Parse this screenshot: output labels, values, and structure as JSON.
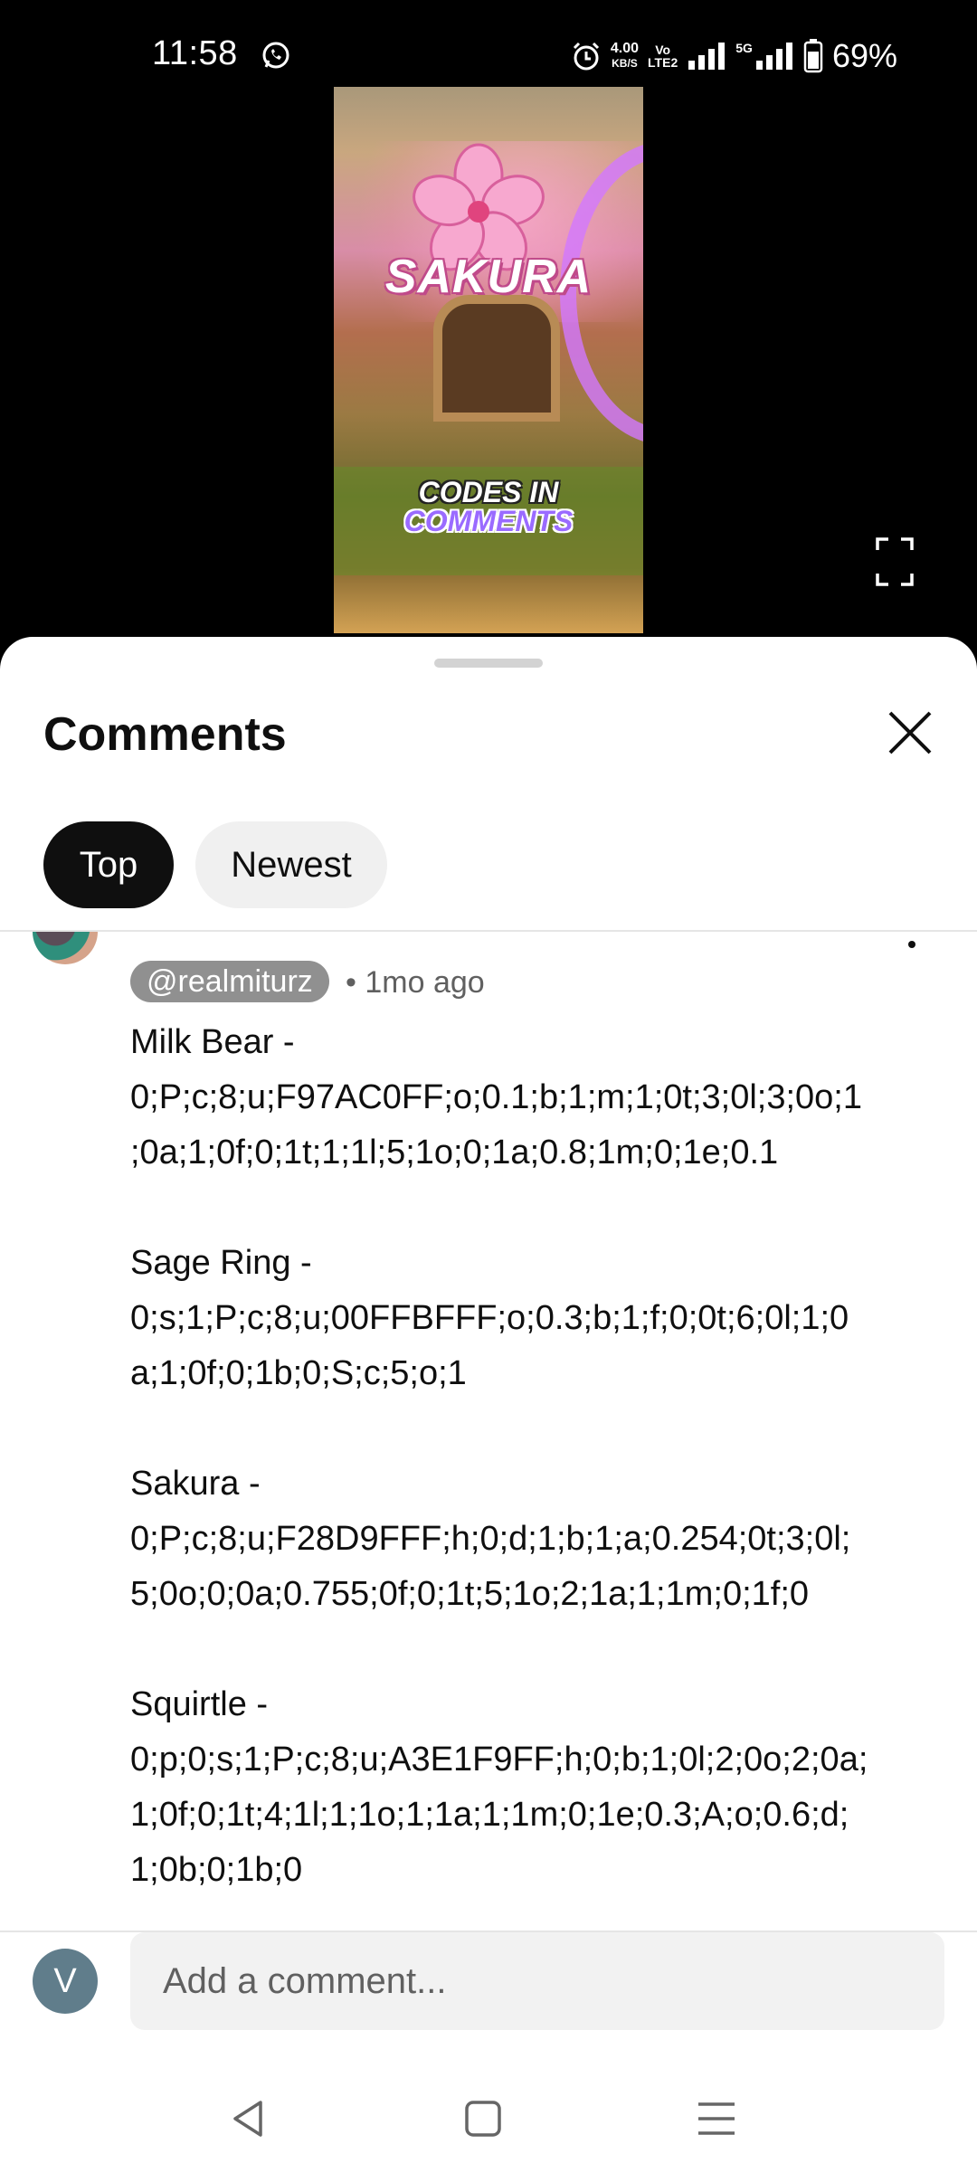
{
  "status_bar": {
    "time": "11:58",
    "net_speed_value": "4.00",
    "net_speed_unit": "KB/S",
    "vo_label": "Vo",
    "lte_label": "LTE2",
    "five_g_label": "5G",
    "battery": "69%"
  },
  "video": {
    "title_overlay": "SAKURA",
    "caption_line1": "CODES IN",
    "caption_line2": "COMMENTS",
    "progress_fraction": 0.645
  },
  "comments_sheet": {
    "title": "Comments",
    "tabs": [
      {
        "label": "Top",
        "selected": true
      },
      {
        "label": "Newest",
        "selected": false
      }
    ],
    "comment": {
      "author": "@realmiturz",
      "separator": "•",
      "time_ago": "1mo ago",
      "blocks": [
        {
          "name": "Milk Bear -",
          "code_lines": [
            "0;P;c;8;u;F97AC0FF;o;0.1;b;1;m;1;0t;3;0l;3;0o;1",
            ";0a;1;0f;0;1t;1;1l;5;1o;0;1a;0.8;1m;0;1e;0.1"
          ]
        },
        {
          "name": "Sage Ring -",
          "code_lines": [
            "0;s;1;P;c;8;u;00FFBFFF;o;0.3;b;1;f;0;0t;6;0l;1;0",
            "a;1;0f;0;1b;0;S;c;5;o;1"
          ]
        },
        {
          "name": "Sakura -",
          "code_lines": [
            "0;P;c;8;u;F28D9FFF;h;0;d;1;b;1;a;0.254;0t;3;0l;",
            "5;0o;0;0a;0.755;0f;0;1t;5;1o;2;1a;1;1m;0;1f;0"
          ]
        },
        {
          "name": "Squirtle -",
          "code_lines": [
            "0;p;0;s;1;P;c;8;u;A3E1F9FF;h;0;b;1;0l;2;0o;2;0a;",
            "1;0f;0;1t;4;1l;1;1o;1;1a;1;1m;0;1e;0.3;A;o;0.6;d;",
            "1;0b;0;1b;0"
          ]
        }
      ]
    },
    "add_comment": {
      "avatar_letter": "V",
      "placeholder": "Add a comment..."
    }
  },
  "colors": {
    "accent_red": "#ff0000",
    "chip_dark": "#0f0f0f",
    "avatar": "#607d8b"
  },
  "icons": [
    "whatsapp-icon",
    "alarm-icon",
    "signal-icon",
    "battery-icon",
    "fullscreen-icon",
    "close-icon",
    "back-icon",
    "home-icon",
    "recents-icon"
  ]
}
